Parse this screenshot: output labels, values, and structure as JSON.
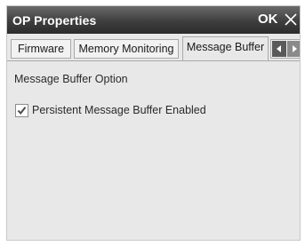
{
  "window": {
    "title": "OP Properties",
    "ok_label": "OK"
  },
  "tabs": [
    {
      "label": "Firmware",
      "active": false
    },
    {
      "label": "Memory Monitoring",
      "active": false
    },
    {
      "label": "Message Buffer",
      "active": true
    }
  ],
  "message_buffer": {
    "section_label": "Message Buffer Option",
    "persistent_checkbox": {
      "label": "Persistent Message Buffer Enabled",
      "checked": true
    }
  },
  "icons": {
    "close": "close-icon",
    "check": "checkmark-icon",
    "tab_scroll_left": "arrow-left-icon",
    "tab_scroll_right": "arrow-right-icon"
  },
  "colors": {
    "titlebar": "#3e3e3e",
    "panel": "#e8e8e8",
    "checkmark": "#4a4a4a"
  }
}
